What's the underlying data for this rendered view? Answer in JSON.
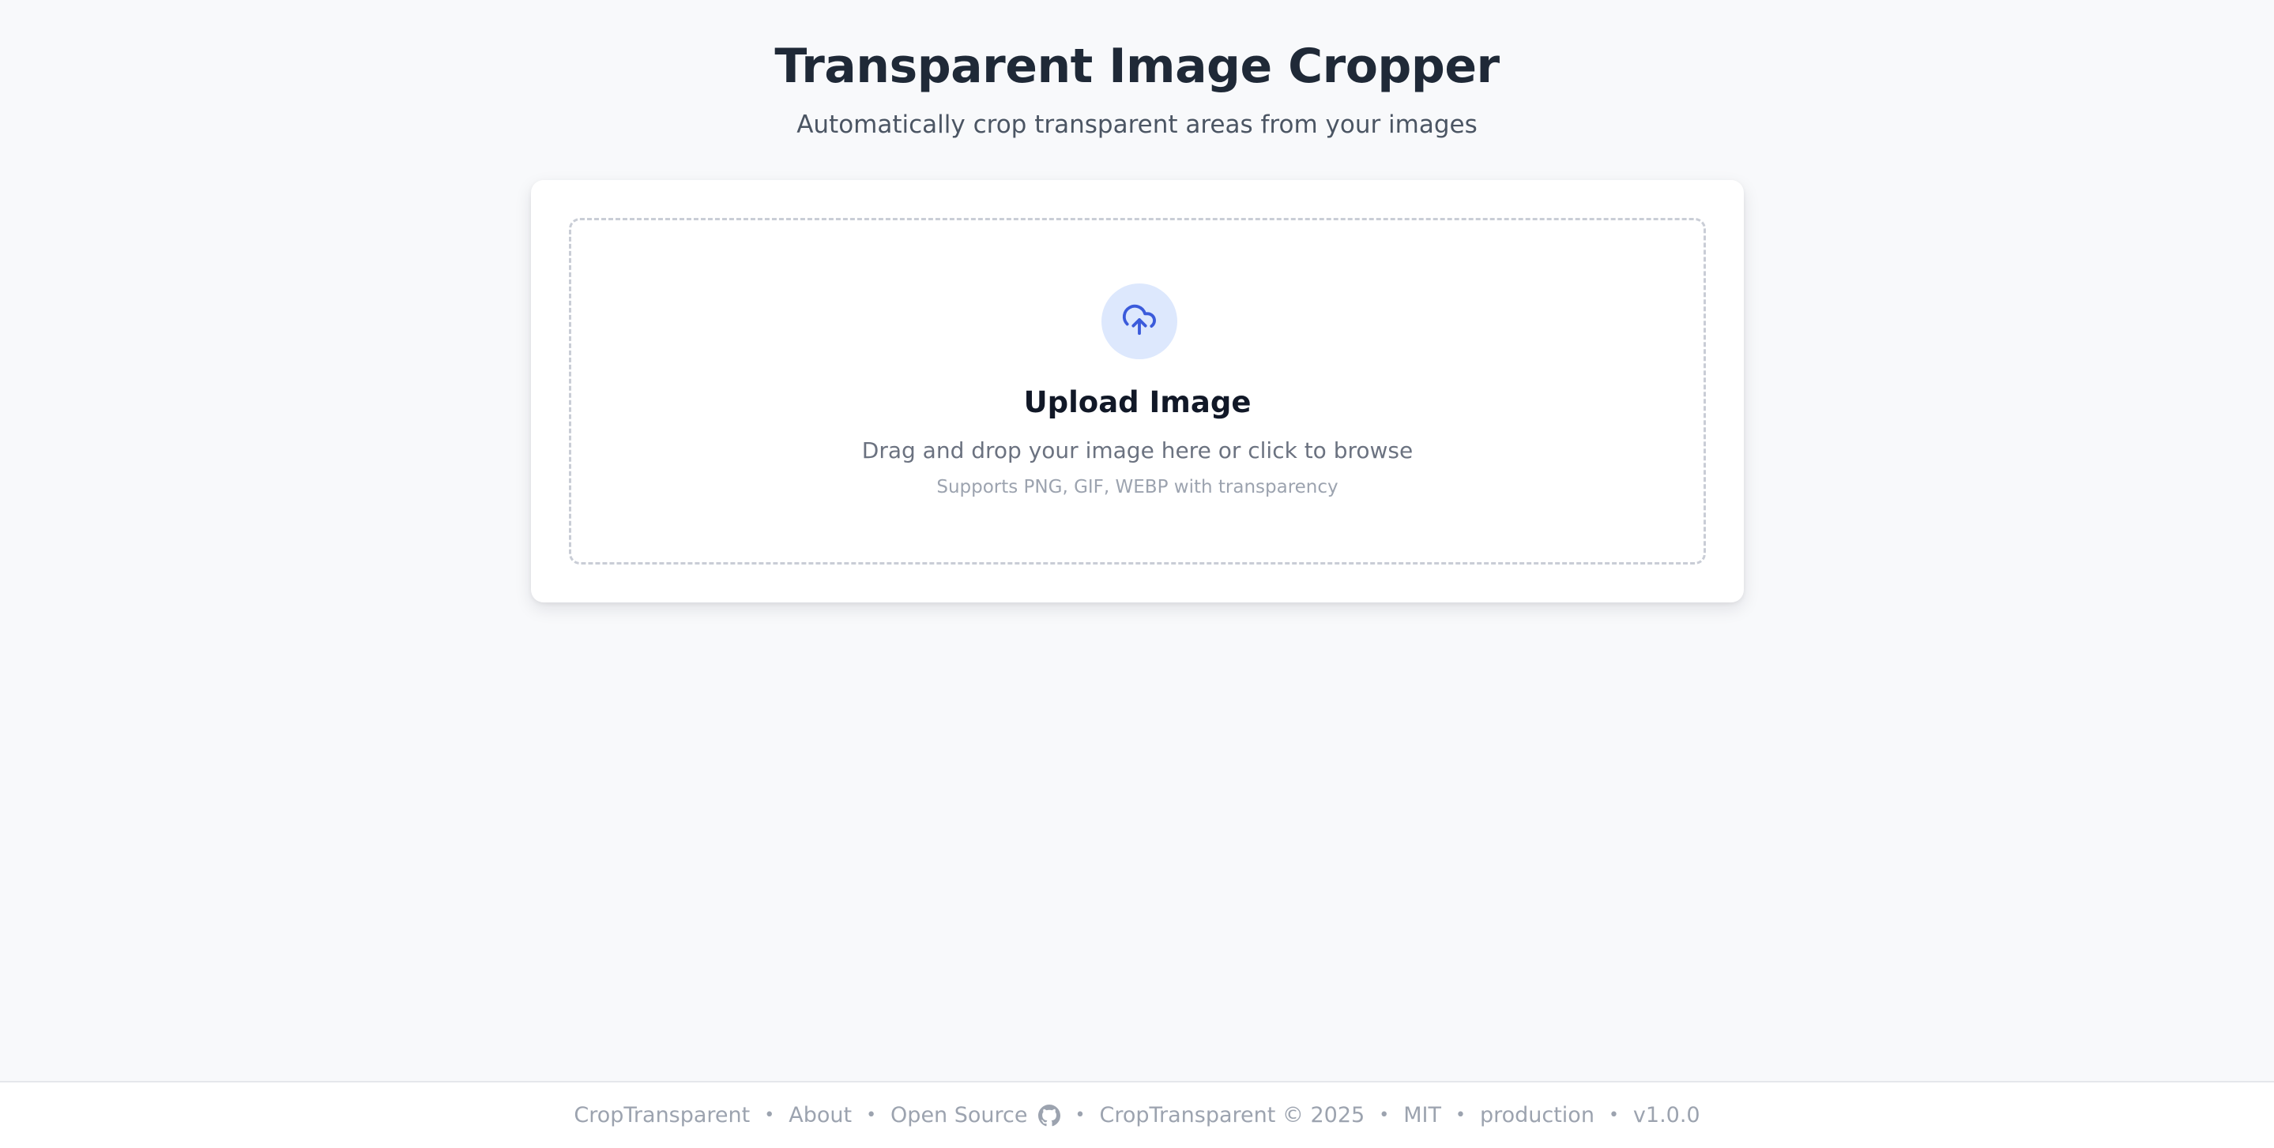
{
  "header": {
    "title": "Transparent Image Cropper",
    "subtitle": "Automatically crop transparent areas from your images"
  },
  "upload": {
    "icon": "cloud-upload-icon",
    "title": "Upload Image",
    "description": "Drag and drop your image here or click to browse",
    "hint": "Supports PNG, GIF, WEBP with transparency"
  },
  "footer": {
    "brand": "CropTransparent",
    "about": "About",
    "open_source": "Open Source",
    "open_source_icon": "github-icon",
    "copyright": "CropTransparent © 2025",
    "license": "MIT",
    "environment": "production",
    "version": "v1.0.0",
    "separator": "•"
  },
  "colors": {
    "background": "#f8f9fb",
    "accent": "#3b5bdb",
    "icon_circle": "#dde8fd"
  }
}
